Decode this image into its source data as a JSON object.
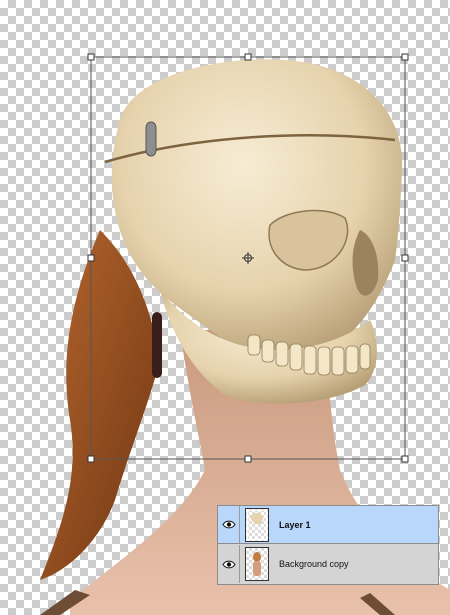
{
  "document": {
    "background": "transparency-checkerboard",
    "content": "photo-composite-skull-on-woman"
  },
  "transform_box": {
    "handles": [
      "top-left",
      "top-center",
      "top-right",
      "middle-left",
      "middle-right",
      "bottom-left",
      "bottom-center",
      "bottom-right"
    ],
    "center_marker": "reference-point-icon"
  },
  "layers_panel": {
    "selected_color": "#b9d6fb",
    "rows": [
      {
        "name": "Layer 1",
        "visible": true,
        "selected": true,
        "eye_icon": "eye-icon"
      },
      {
        "name": "Background copy",
        "visible": true,
        "selected": false,
        "eye_icon": "eye-icon"
      }
    ]
  }
}
